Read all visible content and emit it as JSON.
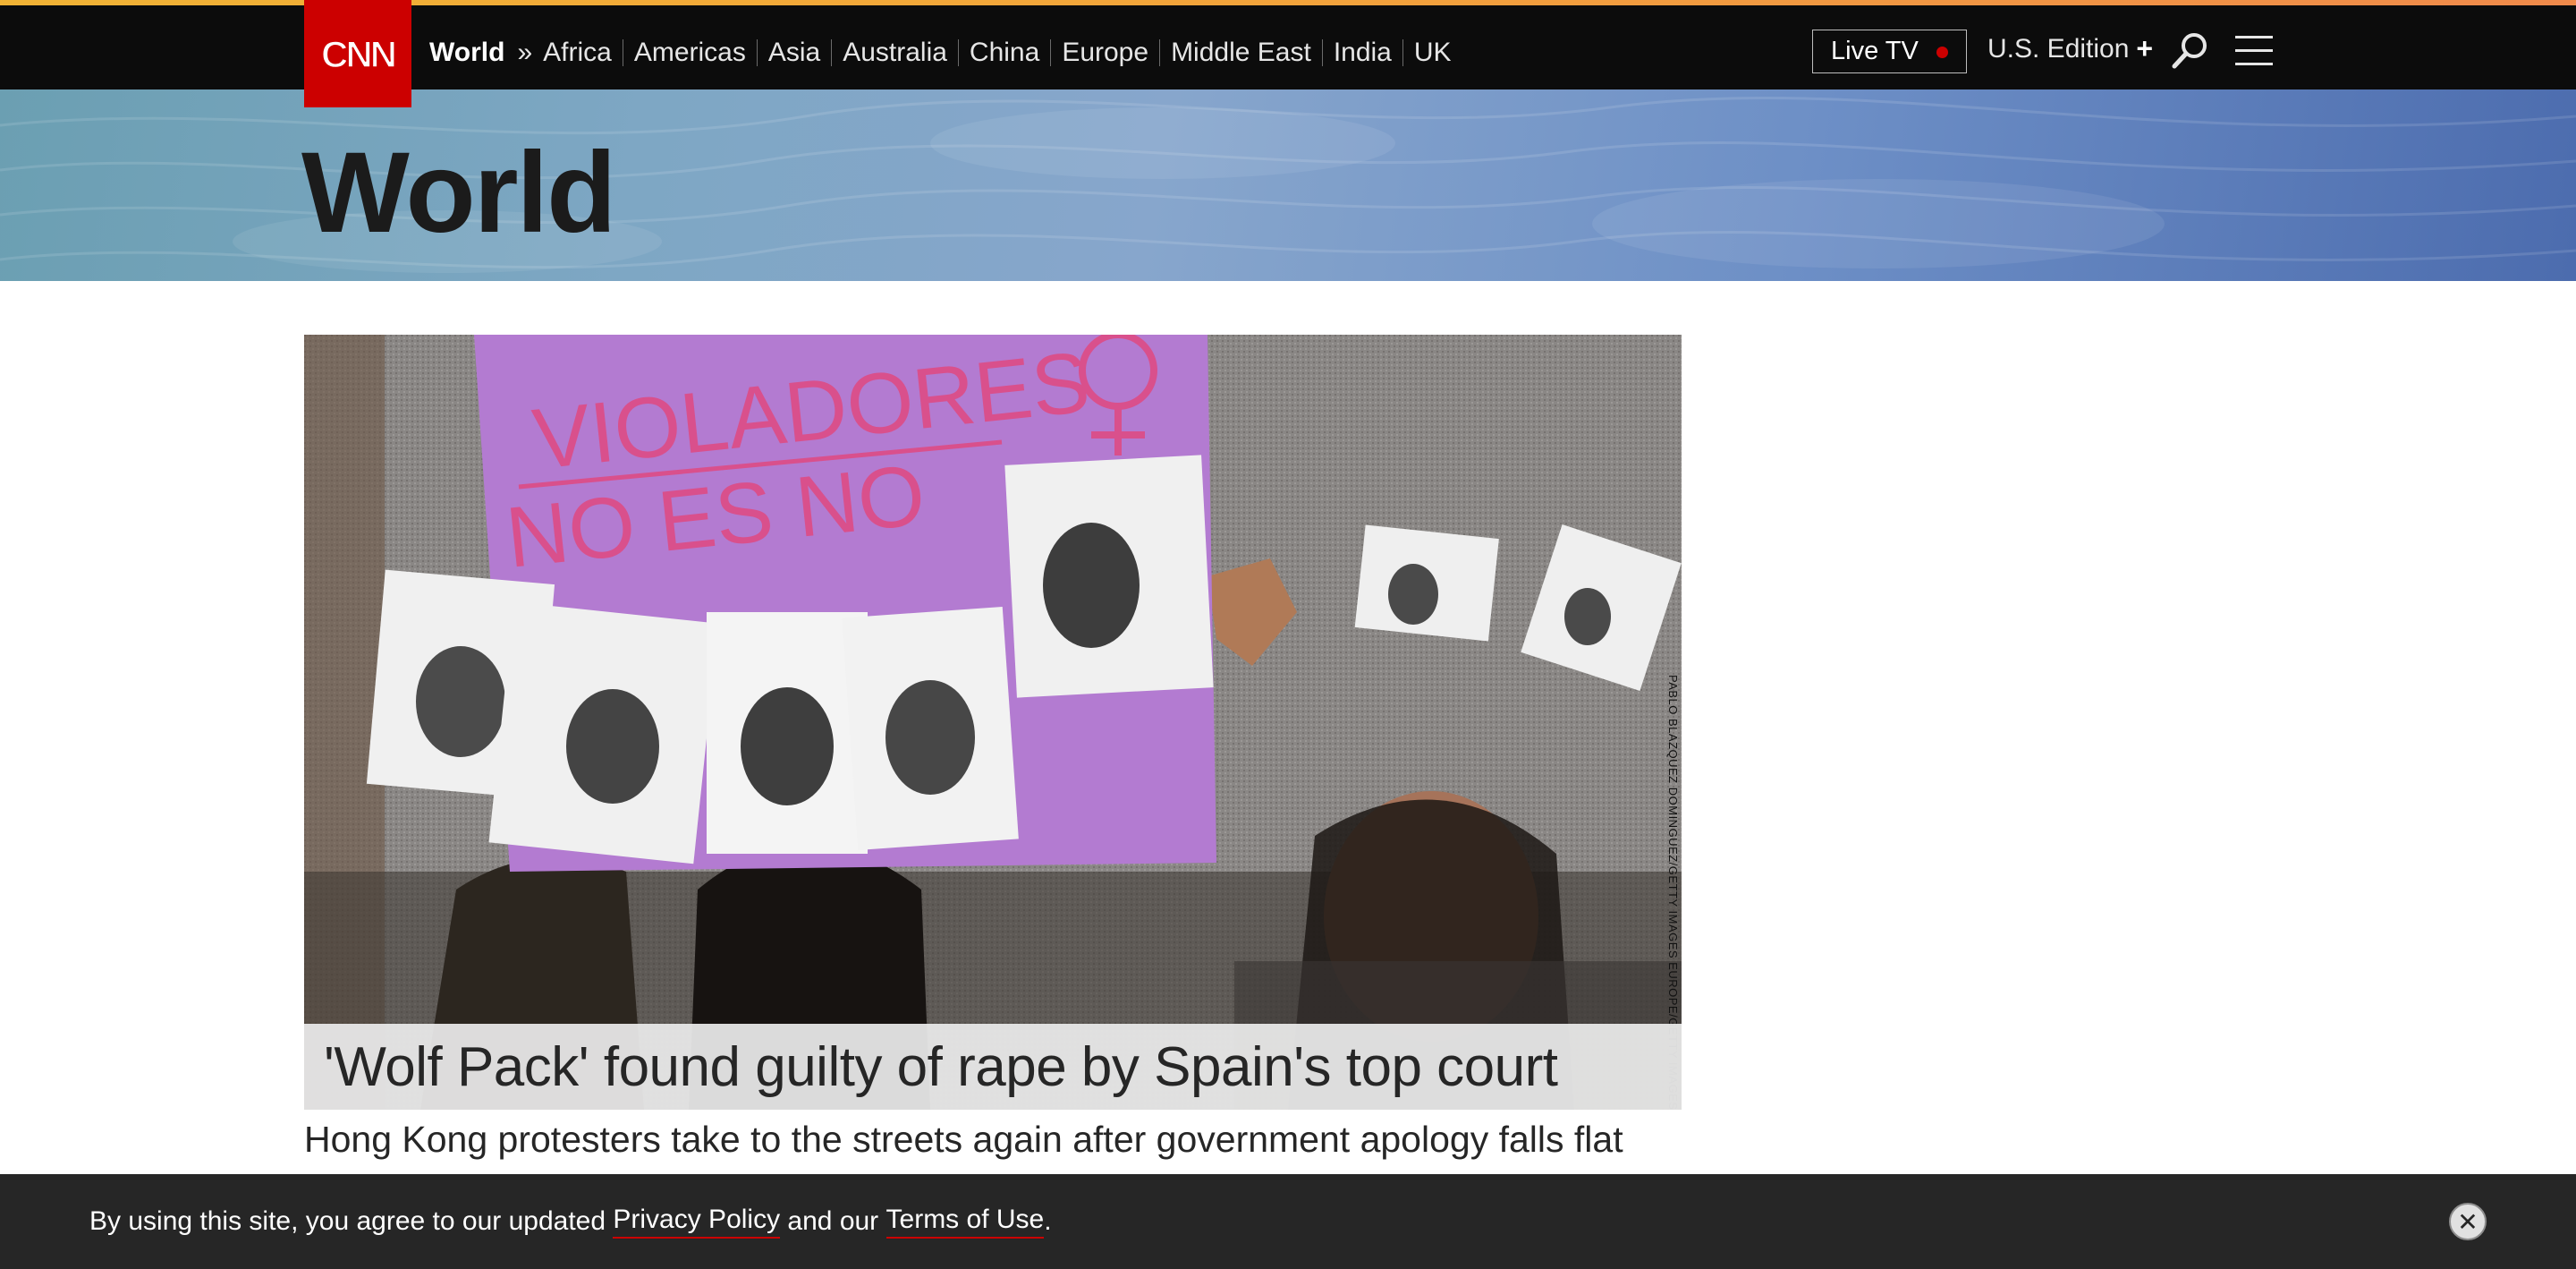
{
  "header": {
    "logo_text": "CNN",
    "section_label": "World",
    "section_arrows": "»",
    "subsections": [
      "Africa",
      "Americas",
      "Asia",
      "Australia",
      "China",
      "Europe",
      "Middle East",
      "India",
      "UK"
    ],
    "live_tv_label": "Live TV",
    "edition_label": "U.S. Edition",
    "edition_plus": "+",
    "search_icon": "search-icon",
    "menu_icon": "hamburger-menu-icon"
  },
  "banner": {
    "page_title": "World"
  },
  "hero": {
    "image_credit": "PABLO BLAZQUEZ DOMINGUEZ/GETTY IMAGES EUROPE/GETTY IMAGES",
    "image_sign_text_line1": "VIOLADORES",
    "image_sign_text_line2": "NO ES NO",
    "headline": "'Wolf Pack' found guilty of rape by Spain's top court"
  },
  "stories": [
    {
      "headline": "Hong Kong protesters take to the streets again after government apology falls flat"
    }
  ],
  "cookie_notice": {
    "text_before": "By using this site, you agree to our updated ",
    "privacy_link": "Privacy Policy",
    "text_middle": " and our ",
    "terms_link": "Terms of Use",
    "text_after": ".",
    "close_label": "✕"
  },
  "colors": {
    "brand_red": "#cc0000",
    "nav_bg": "#0c0c0c",
    "accent_stripe": "#f2a33b",
    "cookie_bg": "#262626"
  }
}
